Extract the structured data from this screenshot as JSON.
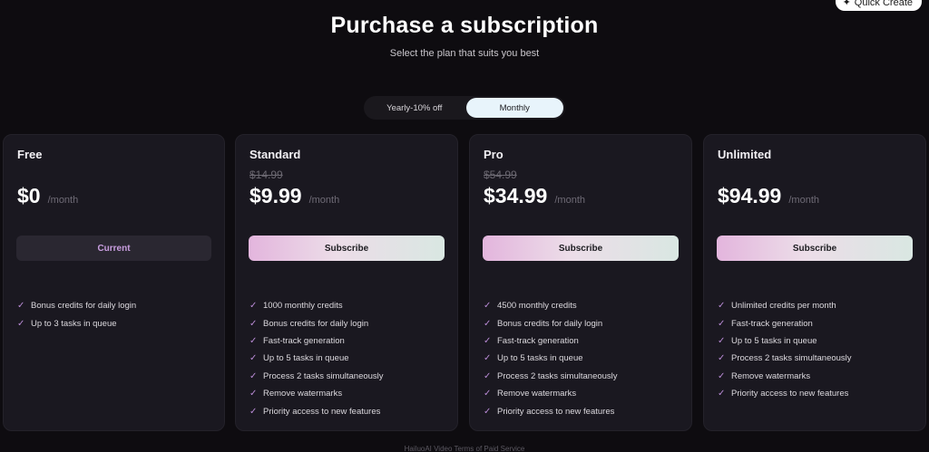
{
  "quick_create": {
    "label": "Quick Create",
    "icon": "sparkle-plus-icon"
  },
  "header": {
    "title": "Purchase a subscription",
    "subtitle": "Select the plan that suits you best"
  },
  "billing_toggle": {
    "options": [
      {
        "label": "Yearly-10% off",
        "active": false
      },
      {
        "label": "Monthly",
        "active": true
      }
    ]
  },
  "plans": [
    {
      "name": "Free",
      "old_price": "",
      "price": "$0",
      "period": "/month",
      "cta": "Current",
      "features": [
        "Bonus credits for daily login",
        "Up to 3 tasks in queue"
      ]
    },
    {
      "name": "Standard",
      "old_price": "$14.99",
      "price": "$9.99",
      "period": "/month",
      "cta": "Subscribe",
      "features": [
        "1000 monthly credits",
        "Bonus credits for daily login",
        "Fast-track generation",
        "Up to 5 tasks in queue",
        "Process 2 tasks simultaneously",
        "Remove watermarks",
        "Priority access to new features"
      ]
    },
    {
      "name": "Pro",
      "old_price": "$54.99",
      "price": "$34.99",
      "period": "/month",
      "cta": "Subscribe",
      "features": [
        "4500 monthly credits",
        "Bonus credits for daily login",
        "Fast-track generation",
        "Up to 5 tasks in queue",
        "Process 2 tasks simultaneously",
        "Remove watermarks",
        "Priority access to new features"
      ]
    },
    {
      "name": "Unlimited",
      "old_price": "",
      "price": "$94.99",
      "period": "/month",
      "cta": "Subscribe",
      "features": [
        "Unlimited credits per month",
        "Fast-track generation",
        "Up to 5 tasks in queue",
        "Process 2 tasks simultaneously",
        "Remove watermarks",
        "Priority access to new features"
      ]
    }
  ],
  "check_glyph": "✓",
  "footer": {
    "text": "HailuoAI Video Terms of Paid Service"
  },
  "colors": {
    "accent_check": "#b98ad6",
    "background": "#0e0c10",
    "card": "#1a1820"
  }
}
